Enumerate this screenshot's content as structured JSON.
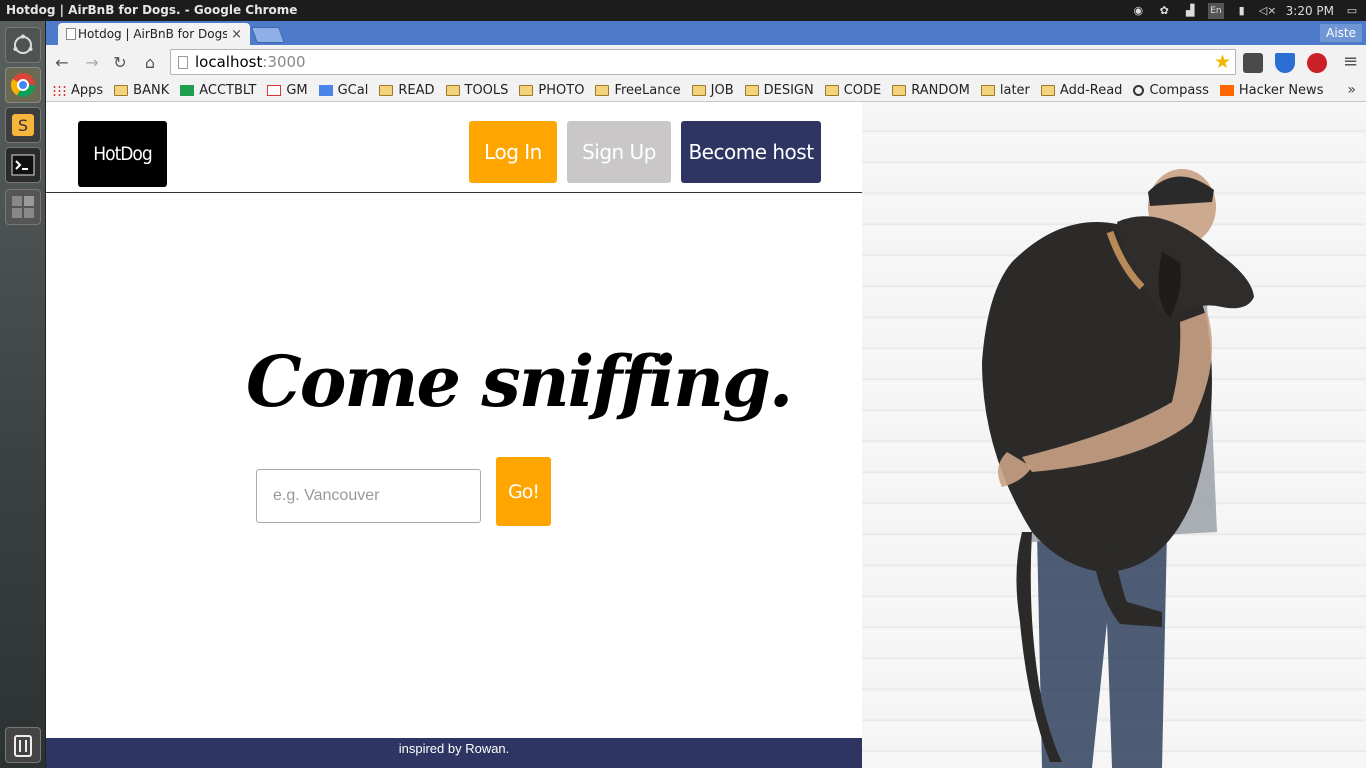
{
  "os_panel": {
    "window_title": "Hotdog | AirBnB for Dogs. - Google Chrome",
    "lang": "En",
    "time": "3:20 PM",
    "tray_icons": [
      "chrome-icon",
      "pidgin-icon",
      "network-icon",
      "lang-icon",
      "battery-icon",
      "volume-mute-icon",
      "settings-icon"
    ]
  },
  "launcher": {
    "items": [
      "dash-home",
      "chrome",
      "sublime-text",
      "terminal",
      "workspace-switcher",
      "trash"
    ]
  },
  "browser": {
    "tab": {
      "title": "Hotdog | AirBnB for Dogs."
    },
    "profile": "Aiste",
    "address": {
      "host": "localhost",
      "port": ":3000"
    },
    "bookmarks": [
      {
        "label": "Apps",
        "icon": "apps-grid"
      },
      {
        "label": "BANK",
        "icon": "folder"
      },
      {
        "label": "ACCTBLT",
        "icon": "sheets"
      },
      {
        "label": "GM",
        "icon": "gmail"
      },
      {
        "label": "GCal",
        "icon": "calendar"
      },
      {
        "label": "READ",
        "icon": "folder"
      },
      {
        "label": "TOOLS",
        "icon": "folder"
      },
      {
        "label": "PHOTO",
        "icon": "folder"
      },
      {
        "label": "FreeLance",
        "icon": "folder"
      },
      {
        "label": "JOB",
        "icon": "folder"
      },
      {
        "label": "DESIGN",
        "icon": "folder"
      },
      {
        "label": "CODE",
        "icon": "folder"
      },
      {
        "label": "RANDOM",
        "icon": "folder"
      },
      {
        "label": "later",
        "icon": "folder"
      },
      {
        "label": "Add-Read",
        "icon": "folder"
      },
      {
        "label": "Compass",
        "icon": "compass"
      },
      {
        "label": "Hacker News",
        "icon": "hn"
      }
    ],
    "bookmarks_overflow": "»"
  },
  "page": {
    "logo": "HotDog",
    "nav": {
      "login": "Log In",
      "signup": "Sign Up",
      "host": "Become host"
    },
    "hero": {
      "title": "Come sniffing."
    },
    "search": {
      "placeholder": "e.g. Vancouver",
      "value": "",
      "go": "Go!"
    },
    "footer": "inspired by Rowan.",
    "colors": {
      "orange": "#ffa500",
      "navy": "#2e3562",
      "gray": "#c9c7c7",
      "black": "#000000"
    }
  }
}
